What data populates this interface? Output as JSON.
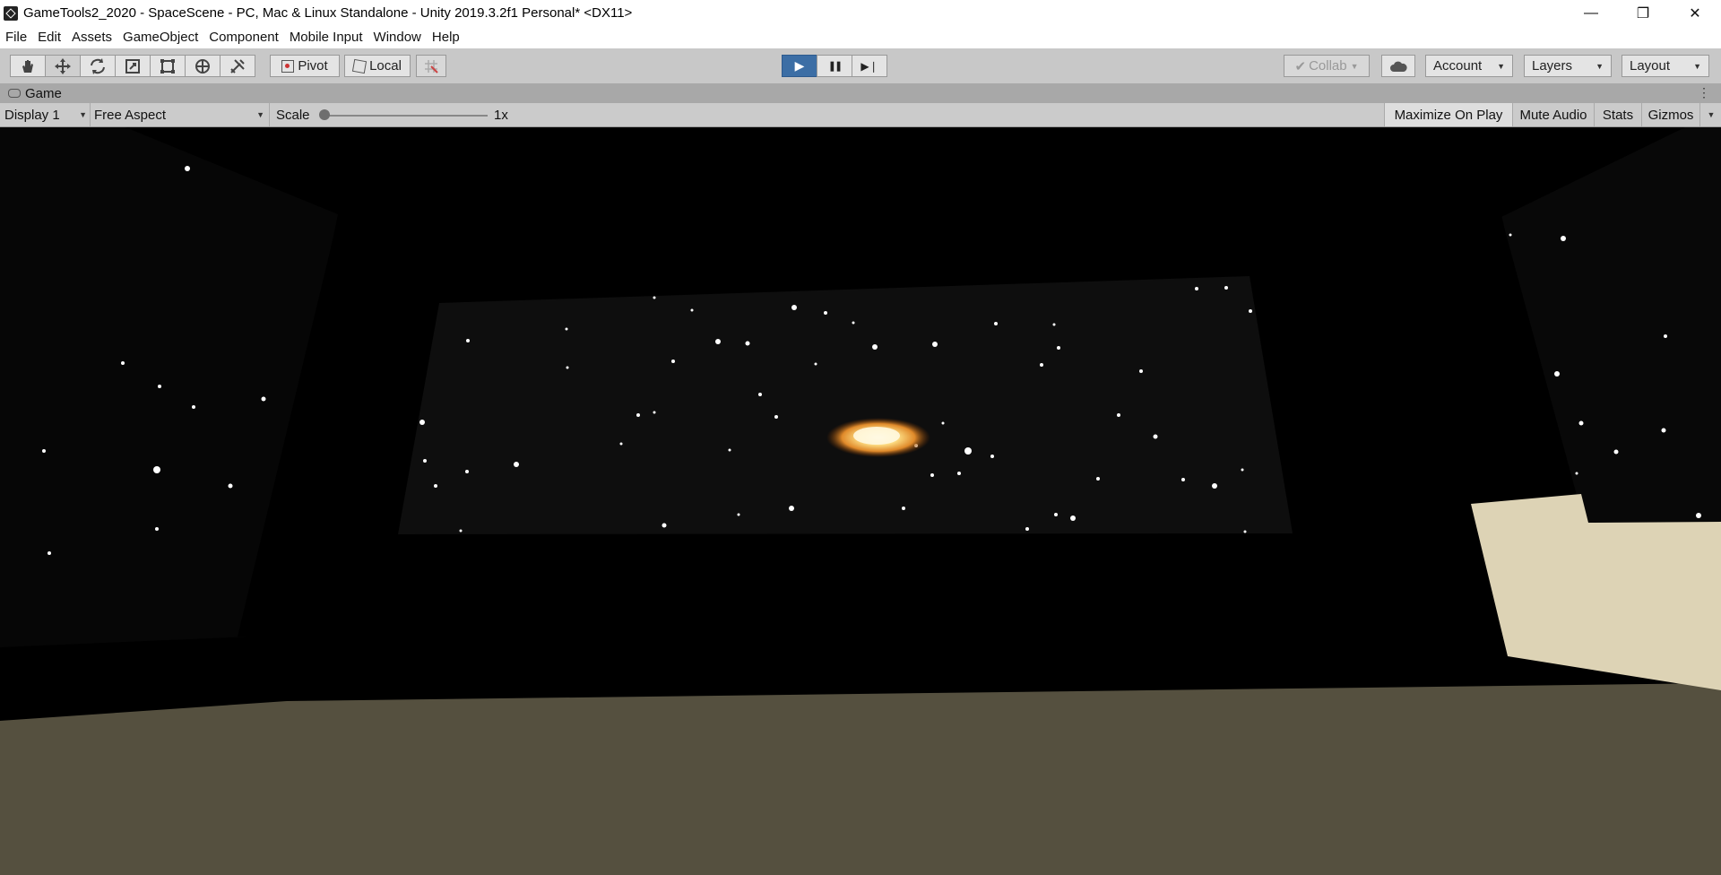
{
  "window": {
    "title": "GameTools2_2020 - SpaceScene - PC, Mac & Linux Standalone - Unity 2019.3.2f1 Personal* <DX11>",
    "minimize_glyph": "—",
    "maximize_glyph": "❐",
    "close_glyph": "✕"
  },
  "menu": {
    "items": [
      "File",
      "Edit",
      "Assets",
      "GameObject",
      "Component",
      "Mobile Input",
      "Window",
      "Help"
    ]
  },
  "toolbar": {
    "tools": [
      "hand-tool-icon",
      "move-tool-icon",
      "rotate-tool-icon",
      "scale-tool-icon",
      "rect-tool-icon",
      "transform-tool-icon",
      "custom-tool-icon"
    ],
    "pivot_label": "Pivot",
    "local_label": "Local",
    "collab_label": "Collab",
    "account_label": "Account",
    "layers_label": "Layers",
    "layout_label": "Layout",
    "play_glyph": "▶",
    "pause_glyph": "❚❚",
    "step_glyph": "▶❘"
  },
  "game_tab": {
    "label": "Game",
    "menu_glyph": "⋮"
  },
  "game_bar": {
    "display": "Display 1",
    "aspect": "Free Aspect",
    "scale_label": "Scale",
    "scale_value": "1x",
    "maximize_on_play": "Maximize On Play",
    "mute_audio": "Mute Audio",
    "stats": "Stats",
    "gizmos": "Gizmos"
  },
  "colors": {
    "toolbar_bg": "#c8c8c8",
    "play_active": "#3c6ea5",
    "floor": "#55503f",
    "cream_block": "#ddd3b5"
  }
}
